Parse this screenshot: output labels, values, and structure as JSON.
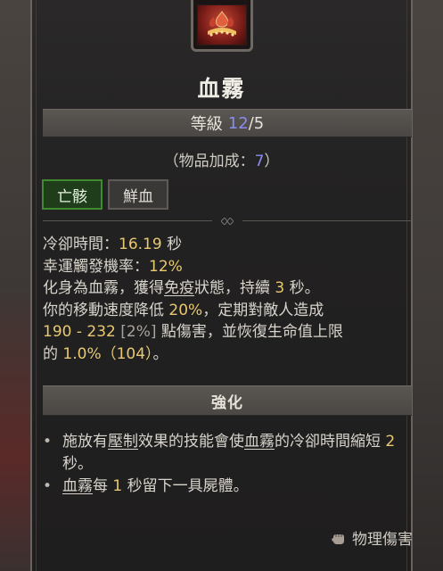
{
  "skill": {
    "name": "血霧",
    "icon": "blood-mist-skill-icon"
  },
  "level": {
    "label": "等級",
    "current": "12",
    "max": "/5"
  },
  "bonus": {
    "prefix": "（物品加成：",
    "value": "7",
    "suffix": "）"
  },
  "tags": [
    {
      "label": "亡骸",
      "active": true
    },
    {
      "label": "鮮血",
      "active": false
    }
  ],
  "stats": {
    "cooldown_label": "冷卻時間：",
    "cooldown_value": "16.19",
    "cooldown_unit": " 秒",
    "lucky_label": "幸運觸發機率：",
    "lucky_value": "12%"
  },
  "description": {
    "line1_a": "化身為血霧，獲得",
    "line1_keyword": "免疫",
    "line1_b": "狀態，持續 ",
    "line1_duration": "3",
    "line1_c": " 秒。",
    "line2_a": "你的移動速度降低 ",
    "line2_slow": "20%",
    "line2_b": "，定期對敵人造成",
    "line3_damage": "190 - 232",
    "line3_pct": " [2%]",
    "line3_b": " 點傷害，並恢復生命值上限",
    "line4_a": "的 ",
    "line4_heal": "1.0%（104）",
    "line4_b": "。"
  },
  "enhancement": {
    "header": "強化",
    "bullet_symbol": "•",
    "item1_a": "施放有",
    "item1_keyword": "壓制",
    "item1_b": "效果的技能會使",
    "item1_skill": "血霧",
    "item1_c": "的冷卻時間縮短 ",
    "item1_value": "2",
    "item1_d": " 秒。",
    "item2_skill": "血霧",
    "item2_a": "每 ",
    "item2_value": "1",
    "item2_b": " 秒留下一具屍體。"
  },
  "damage_type": {
    "label": "物理傷害",
    "icon": "physical-damage-fist-icon"
  },
  "colors": {
    "highlight_yellow": "#e8c870",
    "level_blue": "#8a8cf0",
    "active_tag_green": "#3f8a30"
  }
}
